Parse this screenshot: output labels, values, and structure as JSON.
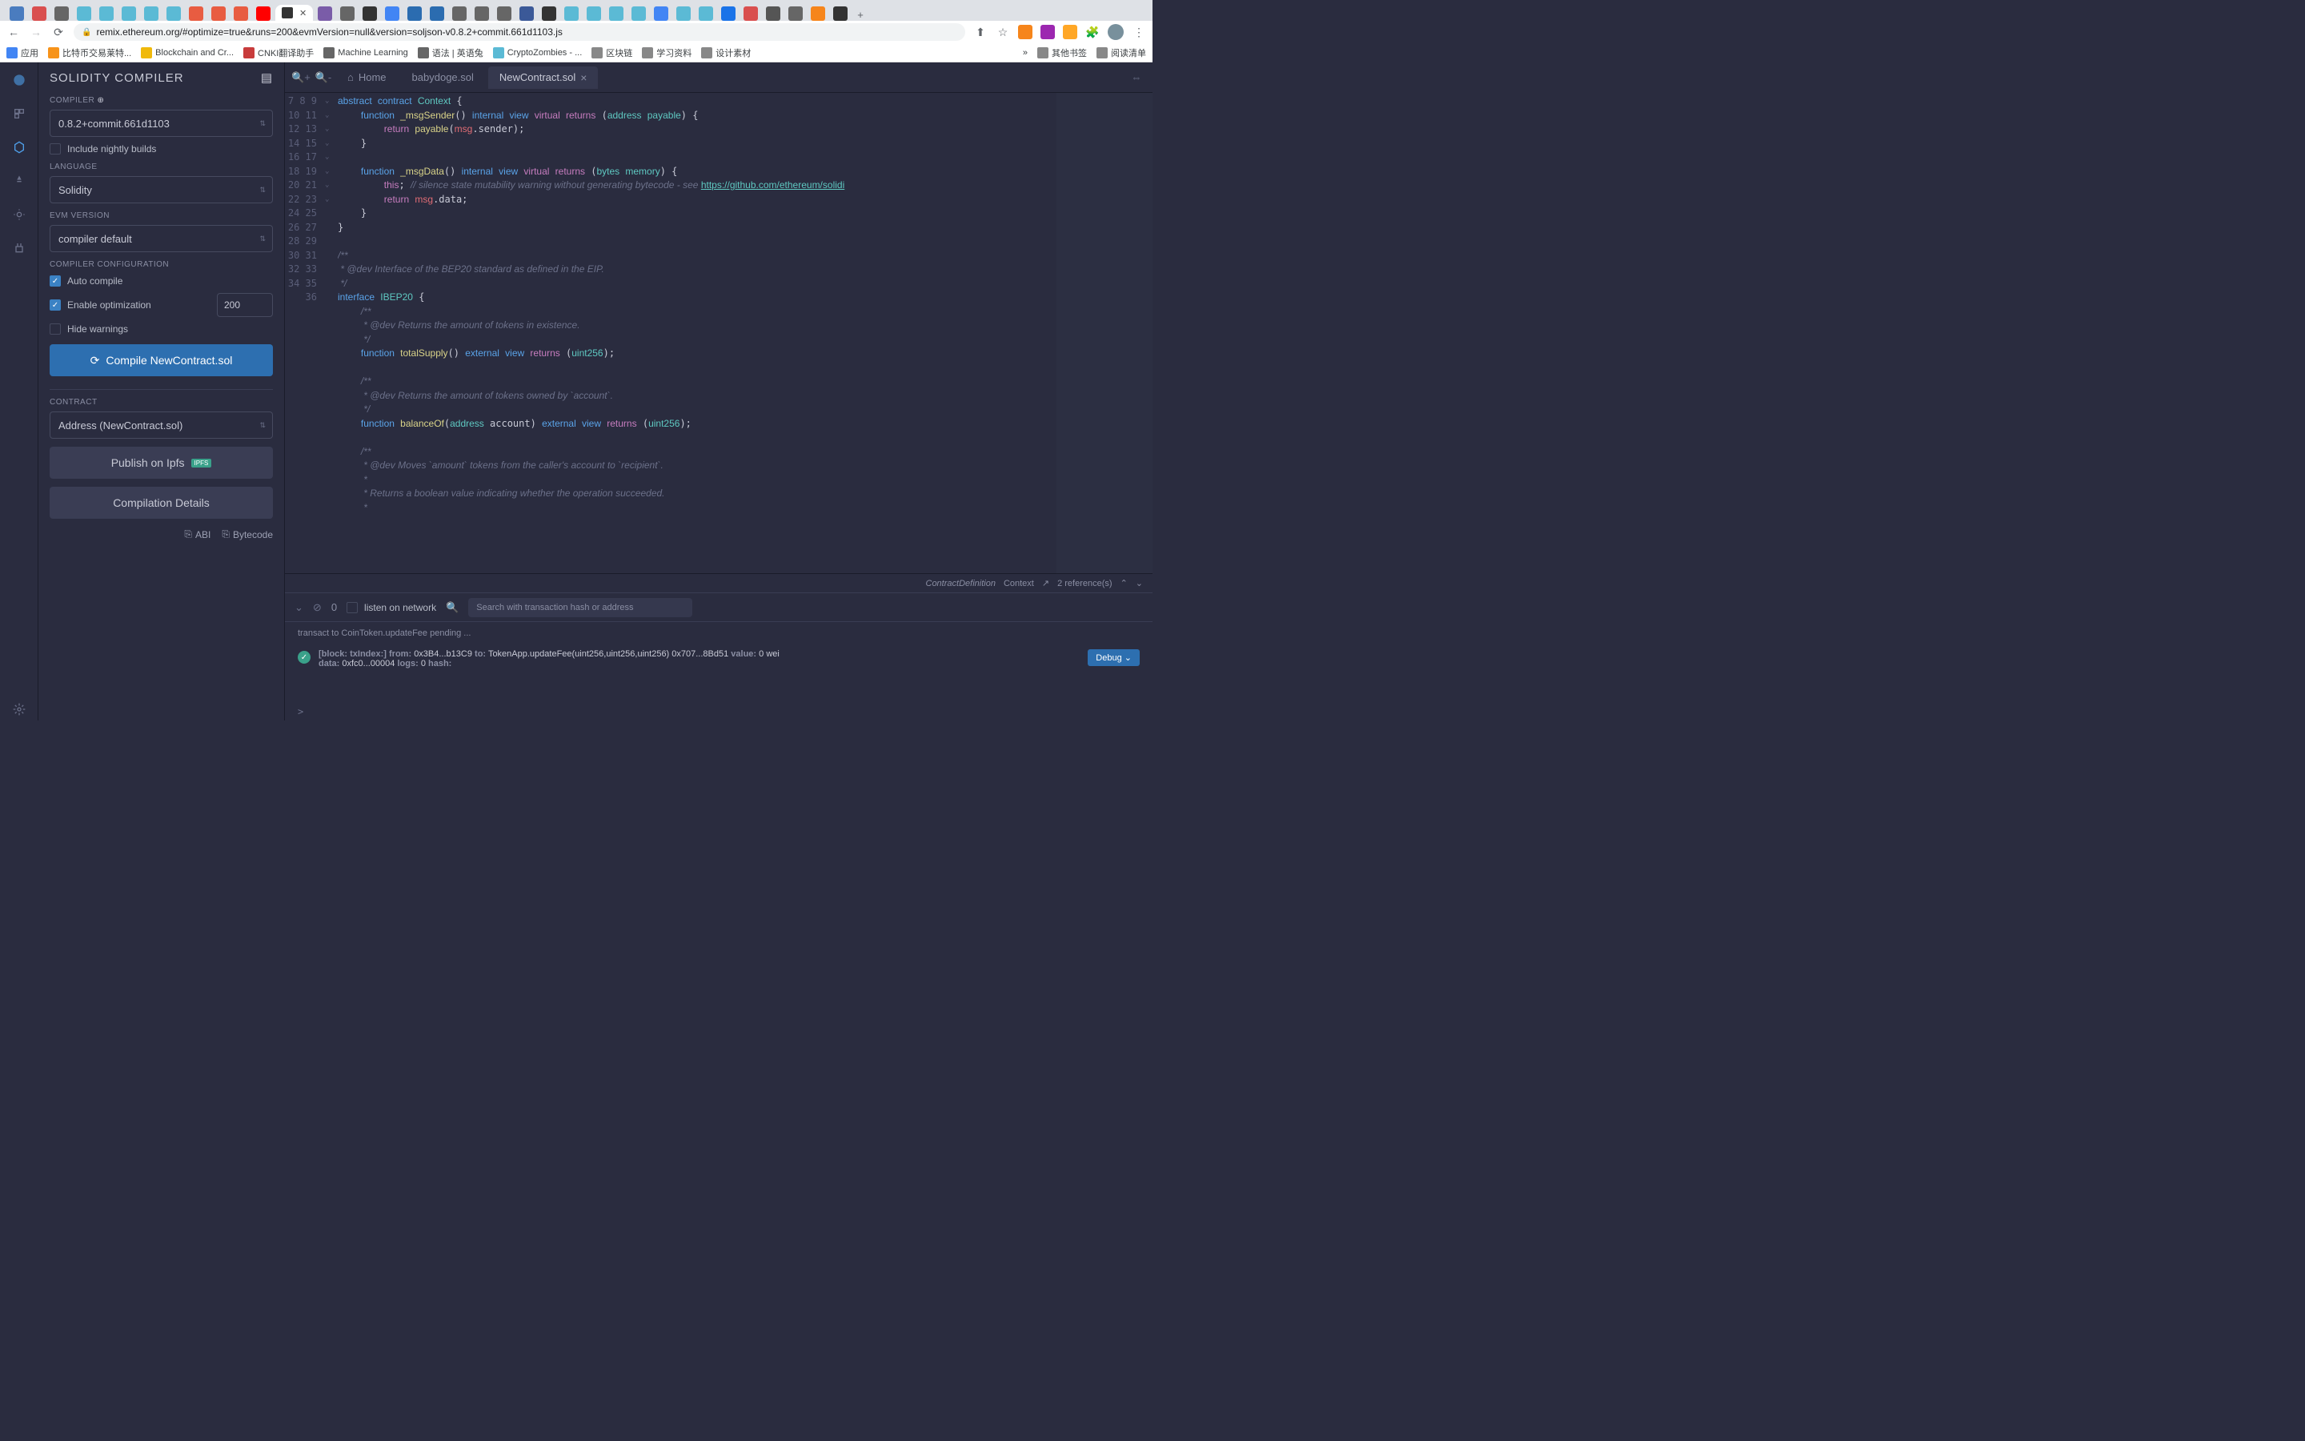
{
  "browser": {
    "url": "remix.ethereum.org/#optimize=true&runs=200&evmVersion=null&version=soljson-v0.8.2+commit.661d1103.js",
    "bookmarks": [
      "应用",
      "比特币交易莱特...",
      "Blockchain and Cr...",
      "CNKI翻译助手",
      "Machine Learning",
      "语法 | 英语兔",
      "CryptoZombies - ...",
      "区块链",
      "学习资料",
      "设计素材"
    ],
    "bookmarks_right": [
      "其他书签",
      "阅读清单"
    ],
    "bookmarks_more": "»"
  },
  "panel": {
    "title": "SOLIDITY COMPILER",
    "sections": {
      "compiler_label": "COMPILER",
      "compiler_value": "0.8.2+commit.661d1103",
      "nightly_label": "Include nightly builds",
      "language_label": "LANGUAGE",
      "language_value": "Solidity",
      "evm_label": "EVM VERSION",
      "evm_value": "compiler default",
      "config_label": "COMPILER CONFIGURATION",
      "auto_compile": "Auto compile",
      "enable_opt": "Enable optimization",
      "opt_runs": "200",
      "hide_warnings": "Hide warnings",
      "compile_btn": "Compile NewContract.sol",
      "contract_label": "CONTRACT",
      "contract_value": "Address (NewContract.sol)",
      "publish_btn": "Publish on Ipfs",
      "details_btn": "Compilation Details",
      "abi": "ABI",
      "bytecode": "Bytecode"
    }
  },
  "editor": {
    "tabs": {
      "home": "Home",
      "tab1": "babydoge.sol",
      "tab2": "NewContract.sol"
    },
    "status": {
      "def": "ContractDefinition",
      "name": "Context",
      "refs": "2 reference(s)"
    },
    "line_start": 7,
    "line_end": 36,
    "fold_lines": [
      7,
      8,
      12,
      18,
      21,
      22,
      27,
      32
    ]
  },
  "terminal": {
    "pending_count": "0",
    "listen_label": "listen on network",
    "search_placeholder": "Search with transaction hash or address",
    "pending_line": "transact to CoinToken.updateFee pending ...",
    "tx": {
      "block_label": "[block: txIndex:]",
      "from_label": "from:",
      "from": "0x3B4...b13C9",
      "to_label": "to:",
      "to": "TokenApp.updateFee(uint256,uint256,uint256) 0x707...8Bd51",
      "value_label": "value:",
      "value": "0 wei",
      "data_label": "data:",
      "data": "0xfc0...00004",
      "logs_label": "logs:",
      "logs": "0",
      "hash_label": "hash:"
    },
    "debug_btn": "Debug",
    "prompt": ">"
  }
}
